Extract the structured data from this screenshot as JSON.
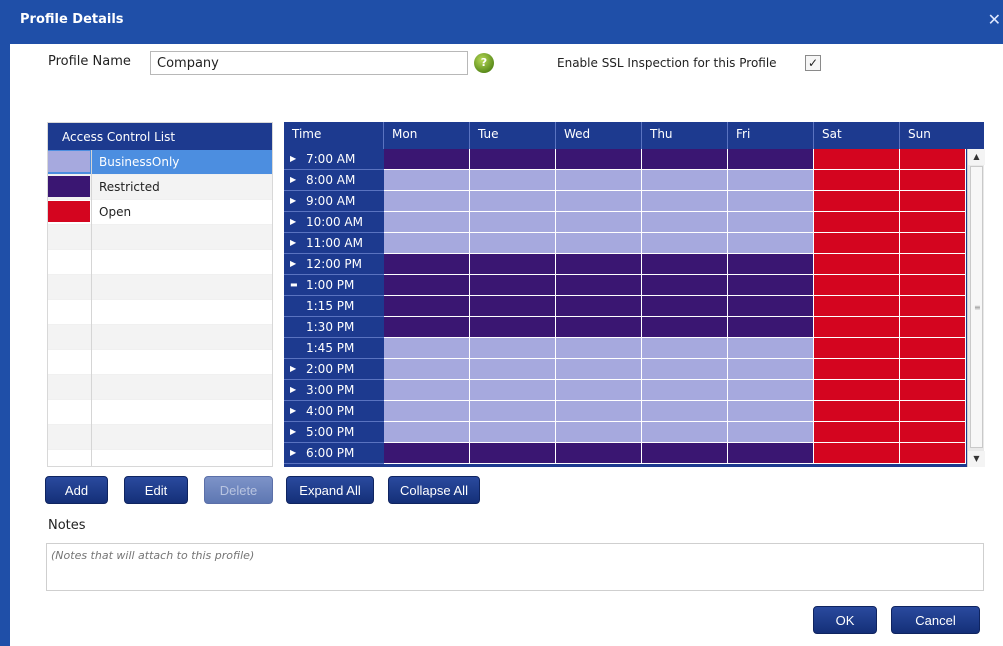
{
  "window": {
    "title": "Profile Details"
  },
  "profile": {
    "name_label": "Profile Name",
    "name_value": "Company",
    "ssl_label": "Enable SSL Inspection for this Profile",
    "ssl_checked": "✓"
  },
  "colors": {
    "business": "#a6a9de",
    "restricted": "#3a1672",
    "open": "#d4051f",
    "header": "#1d3a8f",
    "titlebar": "#1f4fa8"
  },
  "acl": {
    "header": "Access Control List",
    "items": [
      {
        "name": "BusinessOnly",
        "color": "#a6a9de",
        "selected": true
      },
      {
        "name": "Restricted",
        "color": "#3a1672",
        "selected": false
      },
      {
        "name": "Open",
        "color": "#d4051f",
        "selected": false
      }
    ]
  },
  "schedule": {
    "columns": [
      "Time",
      "Mon",
      "Tue",
      "Wed",
      "Thu",
      "Fri",
      "Sat",
      "Sun"
    ],
    "rows": [
      {
        "time": "7:00 AM",
        "marker": "collapsed",
        "days": [
          "R",
          "R",
          "R",
          "R",
          "R",
          "O",
          "O"
        ]
      },
      {
        "time": "8:00 AM",
        "marker": "collapsed",
        "days": [
          "B",
          "B",
          "B",
          "B",
          "B",
          "O",
          "O"
        ]
      },
      {
        "time": "9:00 AM",
        "marker": "collapsed",
        "days": [
          "B",
          "B",
          "B",
          "B",
          "B",
          "O",
          "O"
        ]
      },
      {
        "time": "10:00 AM",
        "marker": "collapsed",
        "days": [
          "B",
          "B",
          "B",
          "B",
          "B",
          "O",
          "O"
        ]
      },
      {
        "time": "11:00 AM",
        "marker": "collapsed",
        "days": [
          "B",
          "B",
          "B",
          "B",
          "B",
          "O",
          "O"
        ]
      },
      {
        "time": "12:00 PM",
        "marker": "collapsed",
        "days": [
          "R",
          "R",
          "R",
          "R",
          "R",
          "O",
          "O"
        ]
      },
      {
        "time": "1:00 PM",
        "marker": "expanded",
        "days": [
          "R",
          "R",
          "R",
          "R",
          "R",
          "O",
          "O"
        ]
      },
      {
        "time": "1:15 PM",
        "marker": "none",
        "days": [
          "R",
          "R",
          "R",
          "R",
          "R",
          "O",
          "O"
        ]
      },
      {
        "time": "1:30 PM",
        "marker": "none",
        "days": [
          "R",
          "R",
          "R",
          "R",
          "R",
          "O",
          "O"
        ]
      },
      {
        "time": "1:45 PM",
        "marker": "none",
        "days": [
          "B",
          "B",
          "B",
          "B",
          "B",
          "O",
          "O"
        ]
      },
      {
        "time": "2:00 PM",
        "marker": "collapsed",
        "days": [
          "B",
          "B",
          "B",
          "B",
          "B",
          "O",
          "O"
        ]
      },
      {
        "time": "3:00 PM",
        "marker": "collapsed",
        "days": [
          "B",
          "B",
          "B",
          "B",
          "B",
          "O",
          "O"
        ]
      },
      {
        "time": "4:00 PM",
        "marker": "collapsed",
        "days": [
          "B",
          "B",
          "B",
          "B",
          "B",
          "O",
          "O"
        ]
      },
      {
        "time": "5:00 PM",
        "marker": "collapsed",
        "days": [
          "B",
          "B",
          "B",
          "B",
          "B",
          "O",
          "O"
        ]
      },
      {
        "time": "6:00 PM",
        "marker": "collapsed",
        "days": [
          "R",
          "R",
          "R",
          "R",
          "R",
          "O",
          "O"
        ]
      }
    ]
  },
  "buttons": {
    "add": "Add",
    "edit": "Edit",
    "delete": "Delete",
    "expand_all": "Expand All",
    "collapse_all": "Collapse All",
    "ok": "OK",
    "cancel": "Cancel"
  },
  "notes": {
    "label": "Notes",
    "placeholder": "(Notes that will attach to this profile)"
  }
}
